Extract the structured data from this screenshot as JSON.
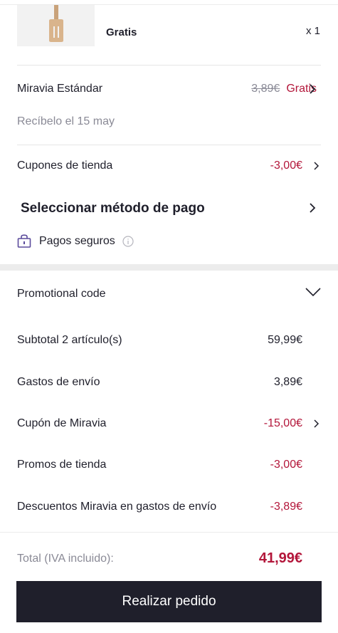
{
  "product": {
    "price_label": "Gratis",
    "quantity": "x 1"
  },
  "shipping": {
    "method": "Miravia Estándar",
    "original_price": "3,89€",
    "price": "Gratis",
    "delivery": "Recíbelo el 15 may"
  },
  "store_coupons": {
    "label": "Cupones de tienda",
    "value": "-3,00€"
  },
  "payment": {
    "title": "Seleccionar método de pago",
    "secure_label": "Pagos seguros"
  },
  "promo": {
    "label": "Promotional code"
  },
  "summary": {
    "subtotal_label": "Subtotal 2 artículo(s)",
    "subtotal_value": "59,99€",
    "shipping_label": "Gastos de envío",
    "shipping_value": "3,89€",
    "miravia_coupon_label": "Cupón de Miravia",
    "miravia_coupon_value": "-15,00€",
    "store_promos_label": "Promos de tienda",
    "store_promos_value": "-3,00€",
    "shipping_discount_label": "Descuentos Miravia en gastos de envío",
    "shipping_discount_value": "-3,89€"
  },
  "total": {
    "label": "Total (IVA incluido):",
    "value": "41,99€"
  },
  "cta": {
    "label": "Realizar pedido"
  },
  "colors": {
    "accent_red": "#b3163a",
    "dark": "#1f1f2b",
    "muted": "#8a8a96",
    "lock_purple": "#5b4b9c"
  }
}
